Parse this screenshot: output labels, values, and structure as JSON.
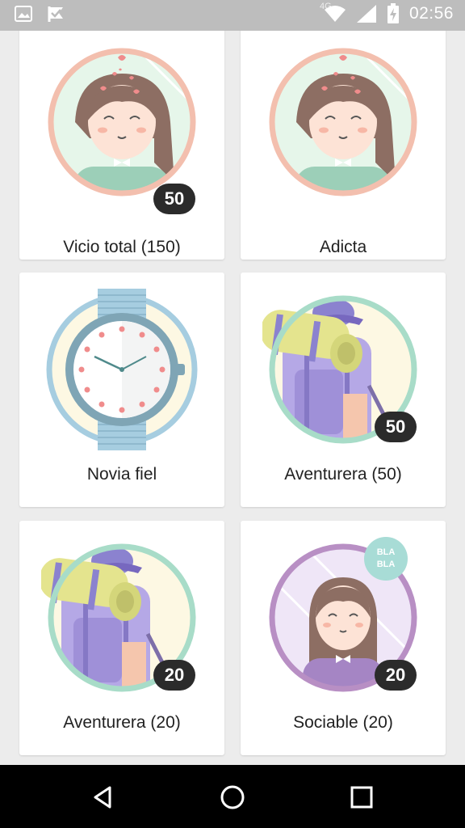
{
  "status_bar": {
    "time": "02:56",
    "network": "4G",
    "icons": [
      "image-icon",
      "check-flag-icon",
      "wifi-icon",
      "signal-icon",
      "battery-charging-icon"
    ]
  },
  "badges": [
    {
      "label": "Vicio total (150)",
      "count": "50",
      "art": "girl-hearts"
    },
    {
      "label": "Adicta",
      "count": "",
      "art": "girl-hearts"
    },
    {
      "label": "Novia fiel",
      "count": "",
      "art": "watch"
    },
    {
      "label": "Aventurera (50)",
      "count": "50",
      "art": "backpack"
    },
    {
      "label": "Aventurera (20)",
      "count": "20",
      "art": "backpack"
    },
    {
      "label": "Sociable (20)",
      "count": "20",
      "art": "girl-bla",
      "bubble_text": [
        "BLA",
        "BLA"
      ]
    }
  ],
  "colors": {
    "salmon": "#f3bfae",
    "mint_bg": "#e6f6ea",
    "blue_ring": "#a6cde0",
    "teal_ring": "#a8dcc8",
    "purple_ring": "#b88fc4",
    "cream": "#fdf8e3"
  },
  "navbar": {
    "icons": [
      "back-icon",
      "home-icon",
      "recents-icon"
    ]
  }
}
